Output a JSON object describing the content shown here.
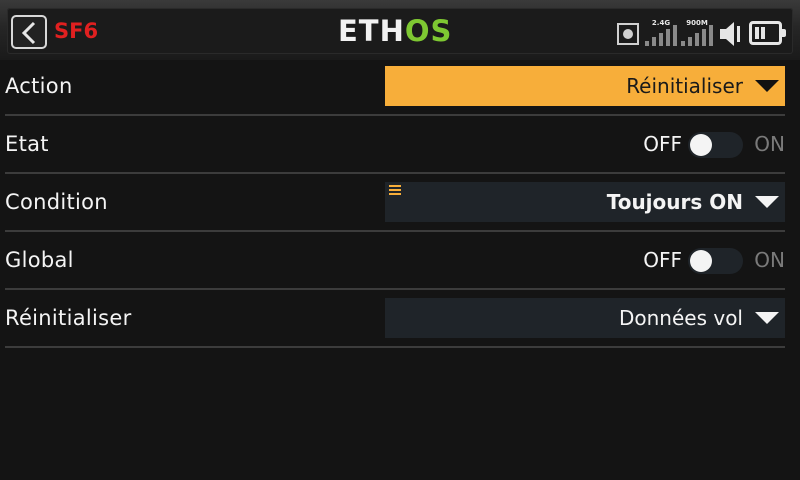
{
  "header": {
    "title": "SF6",
    "logo_part1": "ETH",
    "logo_part2": "OS",
    "signal_labels": [
      "2.4G",
      "900M"
    ]
  },
  "rows": [
    {
      "label": "Action",
      "type": "dropdown",
      "value": "Réinitialiser",
      "active": true
    },
    {
      "label": "Etat",
      "type": "toggle",
      "off_label": "OFF",
      "on_label": "ON",
      "state": "off"
    },
    {
      "label": "Condition",
      "type": "dropdown",
      "value": "Toujours ON",
      "has_menu_icon": true
    },
    {
      "label": "Global",
      "type": "toggle",
      "off_label": "OFF",
      "on_label": "ON",
      "state": "off"
    },
    {
      "label": "Réinitialiser",
      "type": "dropdown",
      "value": "Données vol"
    }
  ],
  "colors": {
    "accent": "#f7ae3a",
    "title_red": "#e02020",
    "logo_green": "#7ec832"
  }
}
